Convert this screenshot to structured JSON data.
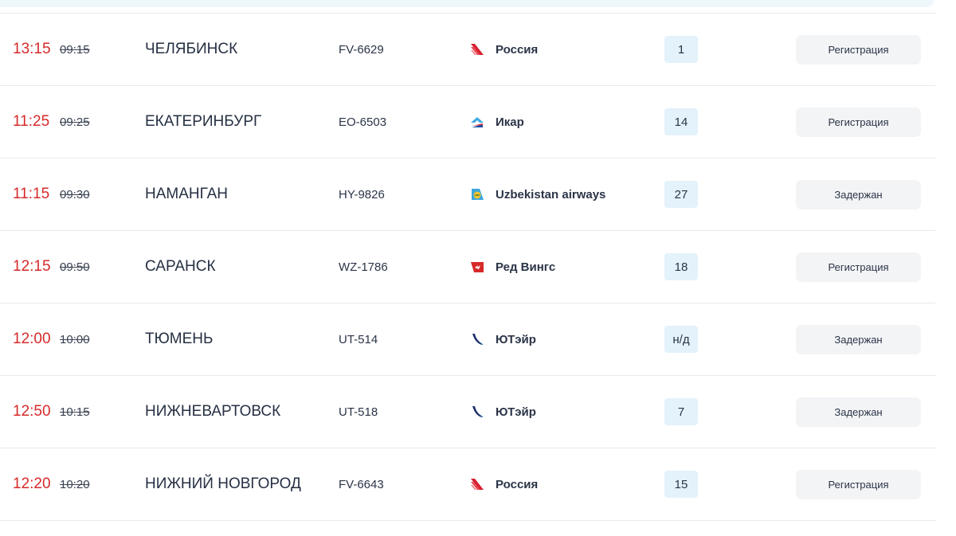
{
  "flights": [
    {
      "actual": "13:15",
      "scheduled": "09:15",
      "city": "ЧЕЛЯБИНСК",
      "flight": "FV-6629",
      "airline": "Россия",
      "airline_logo": "rossiya-logo-icon",
      "gate": "1",
      "status": "Регистрация"
    },
    {
      "actual": "11:25",
      "scheduled": "09:25",
      "city": "ЕКАТЕРИНБУРГ",
      "flight": "EO-6503",
      "airline": "Икар",
      "airline_logo": "ikar-logo-icon",
      "gate": "14",
      "status": "Регистрация"
    },
    {
      "actual": "11:15",
      "scheduled": "09:30",
      "city": "НАМАНГАН",
      "flight": "HY-9826",
      "airline": "Uzbekistan airways",
      "airline_logo": "uzbekistan-airways-logo-icon",
      "gate": "27",
      "status": "Задержан"
    },
    {
      "actual": "12:15",
      "scheduled": "09:50",
      "city": "САРАНСК",
      "flight": "WZ-1786",
      "airline": "Ред Вингс",
      "airline_logo": "red-wings-logo-icon",
      "gate": "18",
      "status": "Регистрация"
    },
    {
      "actual": "12:00",
      "scheduled": "10:00",
      "city": "ТЮМЕНЬ",
      "flight": "UT-514",
      "airline": "ЮТэйр",
      "airline_logo": "utair-logo-icon",
      "gate": "н/д",
      "status": "Задержан"
    },
    {
      "actual": "12:50",
      "scheduled": "10:15",
      "city": "НИЖНЕВАРТОВСК",
      "flight": "UT-518",
      "airline": "ЮТэйр",
      "airline_logo": "utair-logo-icon",
      "gate": "7",
      "status": "Задержан"
    },
    {
      "actual": "12:20",
      "scheduled": "10:20",
      "city": "НИЖНИЙ НОВГОРОД",
      "flight": "FV-6643",
      "airline": "Россия",
      "airline_logo": "rossiya-logo-icon",
      "gate": "15",
      "status": "Регистрация"
    }
  ],
  "colors": {
    "actual_time": "#d62a2a",
    "gate_bg": "#e3f2fb",
    "status_bg": "#f3f4f6",
    "divider": "#e6e9ee",
    "top_strip": "#eef7fc"
  }
}
